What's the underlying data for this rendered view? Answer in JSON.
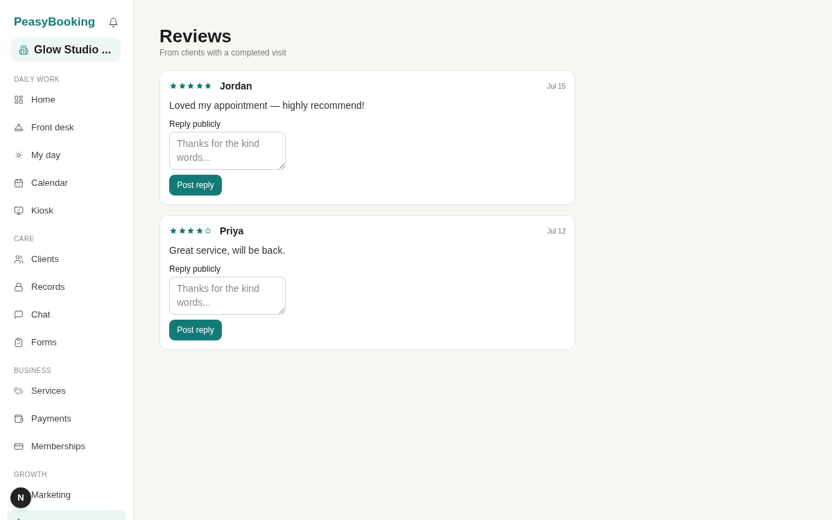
{
  "sidebar": {
    "brand": "PeasyBooking",
    "workspace": {
      "name": "Glow Studio ..."
    },
    "sections": [
      {
        "title": "DAILY WORK",
        "items": [
          {
            "label": "Home",
            "selected": false
          },
          {
            "label": "Front desk",
            "selected": false
          },
          {
            "label": "My day",
            "selected": false
          },
          {
            "label": "Calendar",
            "selected": false
          },
          {
            "label": "Kiosk",
            "selected": false
          }
        ]
      },
      {
        "title": "CARE",
        "items": [
          {
            "label": "Clients",
            "selected": false
          },
          {
            "label": "Records",
            "selected": false
          },
          {
            "label": "Chat",
            "selected": false
          },
          {
            "label": "Forms",
            "selected": false
          }
        ]
      },
      {
        "title": "BUSINESS",
        "items": [
          {
            "label": "Services",
            "selected": false
          },
          {
            "label": "Payments",
            "selected": false
          },
          {
            "label": "Memberships",
            "selected": false
          }
        ]
      },
      {
        "title": "GROWTH",
        "items": [
          {
            "label": "Marketing",
            "selected": false
          },
          {
            "selected": true
          }
        ]
      }
    ]
  },
  "dev_badge": {
    "label": "N"
  },
  "page": {
    "title": "Reviews",
    "subtitle": "From clients with a completed visit"
  },
  "reviews": [
    {
      "stars": 5,
      "author": "Jordan",
      "date": "Jul 15",
      "text": "Loved my appointment — highly recommend!",
      "reply": {
        "label": "Reply publicly",
        "placeholder": "Thanks for the kind words..."
      },
      "button": "Post reply"
    },
    {
      "stars": 4,
      "author": "Priya",
      "date": "Jul 12",
      "text": "Great service, will be back.",
      "reply": {
        "label": "Reply publicly",
        "placeholder": "Thanks for the kind words..."
      },
      "button": "Post reply"
    }
  ]
}
